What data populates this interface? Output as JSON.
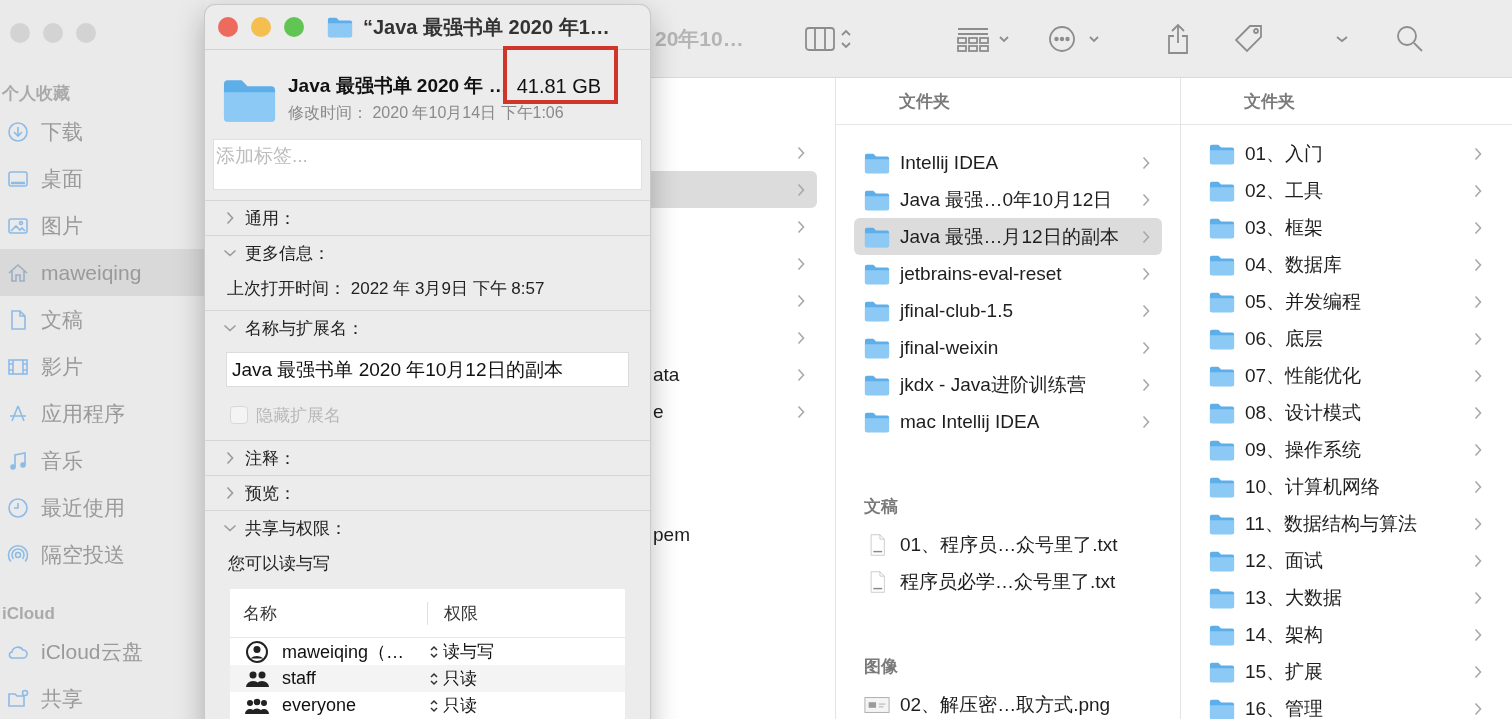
{
  "finder": {
    "sidebar": {
      "groups": [
        {
          "title": "个人收藏",
          "items": [
            {
              "label": "下载",
              "selected": false
            },
            {
              "label": "桌面",
              "selected": false
            },
            {
              "label": "图片",
              "selected": false
            },
            {
              "label": "maweiqing",
              "selected": true
            },
            {
              "label": "文稿",
              "selected": false
            },
            {
              "label": "影片",
              "selected": false
            },
            {
              "label": "应用程序",
              "selected": false
            },
            {
              "label": "音乐",
              "selected": false
            },
            {
              "label": "最近使用",
              "selected": false
            },
            {
              "label": "隔空投送",
              "selected": false
            }
          ]
        },
        {
          "title": "iCloud",
          "items": [
            {
              "label": "iCloud云盘",
              "selected": false
            },
            {
              "label": "共享",
              "selected": false
            }
          ]
        }
      ]
    },
    "toolbar": {
      "title": "20年10…"
    },
    "columns": [
      {
        "sections": [
          {
            "rows": [
              {
                "kind": "folder",
                "selected": false
              },
              {
                "kind": "folder",
                "selected": true
              },
              {
                "kind": "folder",
                "selected": false
              },
              {
                "kind": "folder",
                "selected": false
              },
              {
                "kind": "folder",
                "selected": false
              },
              {
                "kind": "folder",
                "selected": false
              },
              {
                "kind": "folder",
                "label": "ata",
                "selected": false
              },
              {
                "kind": "folder",
                "label": "e",
                "selected": false
              }
            ]
          },
          {
            "rows": [
              {
                "kind": "file",
                "label": "pem",
                "selected": false
              }
            ]
          }
        ]
      },
      {
        "sections": [
          {
            "title": "文件夹",
            "rows": [
              {
                "kind": "folder",
                "label": "Intellij IDEA",
                "selected": false
              },
              {
                "kind": "folder",
                "label": "Java 最强…0年10月12日",
                "selected": false
              },
              {
                "kind": "folder",
                "label": "Java 最强…月12日的副本",
                "selected": true
              },
              {
                "kind": "folder",
                "label": "jetbrains-eval-reset",
                "selected": false
              },
              {
                "kind": "folder",
                "label": "jfinal-club-1.5",
                "selected": false
              },
              {
                "kind": "folder",
                "label": "jfinal-weixin",
                "selected": false
              },
              {
                "kind": "folder",
                "label": "jkdx - Java进阶训练营",
                "selected": false
              },
              {
                "kind": "folder",
                "label": "mac Intellij IDEA",
                "selected": false
              }
            ]
          },
          {
            "title": "文稿",
            "rows": [
              {
                "kind": "text",
                "label": "01、程序员…众号里了.txt",
                "selected": false
              },
              {
                "kind": "text",
                "label": "程序员必学…众号里了.txt",
                "selected": false
              }
            ]
          },
          {
            "title": "图像",
            "rows": [
              {
                "kind": "image",
                "label": "02、解压密…取方式.png",
                "selected": false
              }
            ]
          }
        ]
      },
      {
        "sections": [
          {
            "title": "文件夹",
            "rows": [
              {
                "kind": "folder",
                "label": "01、入门",
                "selected": false
              },
              {
                "kind": "folder",
                "label": "02、工具",
                "selected": false
              },
              {
                "kind": "folder",
                "label": "03、框架",
                "selected": false
              },
              {
                "kind": "folder",
                "label": "04、数据库",
                "selected": false
              },
              {
                "kind": "folder",
                "label": "05、并发编程",
                "selected": false
              },
              {
                "kind": "folder",
                "label": "06、底层",
                "selected": false
              },
              {
                "kind": "folder",
                "label": "07、性能优化",
                "selected": false
              },
              {
                "kind": "folder",
                "label": "08、设计模式",
                "selected": false
              },
              {
                "kind": "folder",
                "label": "09、操作系统",
                "selected": false
              },
              {
                "kind": "folder",
                "label": "10、计算机网络",
                "selected": false
              },
              {
                "kind": "folder",
                "label": "11、数据结构与算法",
                "selected": false
              },
              {
                "kind": "folder",
                "label": "12、面试",
                "selected": false
              },
              {
                "kind": "folder",
                "label": "13、大数据",
                "selected": false
              },
              {
                "kind": "folder",
                "label": "14、架构",
                "selected": false
              },
              {
                "kind": "folder",
                "label": "15、扩展",
                "selected": false
              },
              {
                "kind": "folder",
                "label": "16、管理",
                "selected": false
              }
            ]
          }
        ]
      }
    ]
  },
  "info_window": {
    "title": "“Java 最强书单 2020 年1…",
    "name": "Java 最强书单 2020 年 …",
    "size": {
      "text": "41.81 GB",
      "highlighted": true
    },
    "modified": "修改时间： 2020 年10月14日 下午1:06",
    "tags": {
      "placeholder": "添加标签..."
    },
    "sections": [
      {
        "title": "通用：",
        "expanded": false
      },
      {
        "kind": "info",
        "title": "更多信息：",
        "expanded": true,
        "text": "上次打开时间： 2022 年 3月9日 下午 8:57"
      },
      {
        "kind": "name",
        "title": "名称与扩展名：",
        "expanded": true,
        "value": "Java 最强书单 2020 年10月12日的副本",
        "hide_extension": {
          "label": "隐藏扩展名",
          "checked": false,
          "disabled": true
        }
      },
      {
        "title": "注释：",
        "expanded": false
      },
      {
        "title": "预览：",
        "expanded": false
      },
      {
        "kind": "sharing",
        "title": "共享与权限：",
        "expanded": true,
        "summary": "您可以读与写",
        "table": {
          "columns": [
            "名称",
            "权限"
          ],
          "rows": [
            {
              "name": "maweiqing（…",
              "privilege": "读与写"
            },
            {
              "name": "staff",
              "privilege": "只读"
            },
            {
              "name": "everyone",
              "privilege": "只读"
            }
          ]
        }
      }
    ]
  }
}
